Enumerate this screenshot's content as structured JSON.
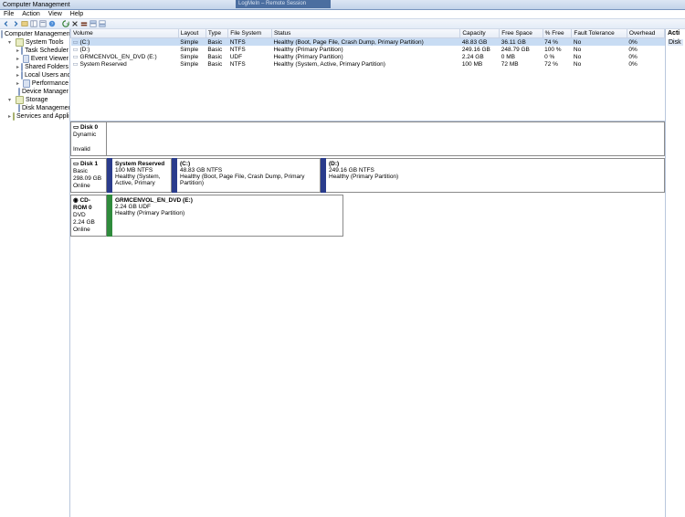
{
  "title": "Computer Management",
  "remote_bar": "LogMeIn – Remote Session",
  "menu": {
    "file": "File",
    "action": "Action",
    "view": "View",
    "help": "Help"
  },
  "tree": {
    "root": "Computer Management (Local)",
    "system_tools": "System Tools",
    "task_scheduler": "Task Scheduler",
    "event_viewer": "Event Viewer",
    "shared_folders": "Shared Folders",
    "local_users": "Local Users and Groups",
    "performance": "Performance",
    "device_manager": "Device Manager",
    "storage": "Storage",
    "disk_mgmt": "Disk Management",
    "services_apps": "Services and Applications"
  },
  "actions_label": "Acti",
  "actions_item": "Disk",
  "columns": {
    "volume": "Volume",
    "layout": "Layout",
    "type": "Type",
    "fs": "File System",
    "status": "Status",
    "capacity": "Capacity",
    "free": "Free Space",
    "pct": "% Free",
    "fault": "Fault Tolerance",
    "overhead": "Overhead"
  },
  "volumes": [
    {
      "name": "(C:)",
      "layout": "Simple",
      "type": "Basic",
      "fs": "NTFS",
      "status": "Healthy (Boot, Page File, Crash Dump, Primary Partition)",
      "cap": "48.83 GB",
      "free": "36.11 GB",
      "pct": "74 %",
      "fault": "No",
      "oh": "0%"
    },
    {
      "name": "(D:)",
      "layout": "Simple",
      "type": "Basic",
      "fs": "NTFS",
      "status": "Healthy (Primary Partition)",
      "cap": "249.16 GB",
      "free": "248.79 GB",
      "pct": "100 %",
      "fault": "No",
      "oh": "0%"
    },
    {
      "name": "GRMCENVOL_EN_DVD (E:)",
      "layout": "Simple",
      "type": "Basic",
      "fs": "UDF",
      "status": "Healthy (Primary Partition)",
      "cap": "2.24 GB",
      "free": "0 MB",
      "pct": "0 %",
      "fault": "No",
      "oh": "0%"
    },
    {
      "name": "System Reserved",
      "layout": "Simple",
      "type": "Basic",
      "fs": "NTFS",
      "status": "Healthy (System, Active, Primary Partition)",
      "cap": "100 MB",
      "free": "72 MB",
      "pct": "72 %",
      "fault": "No",
      "oh": "0%"
    }
  ],
  "disks": {
    "d0": {
      "label": "Disk 0",
      "type": "Dynamic",
      "status": "Invalid"
    },
    "d1": {
      "label": "Disk 1",
      "type": "Basic",
      "size": "298.09 GB",
      "status": "Online",
      "p1": {
        "name": "System Reserved",
        "info": "100 MB NTFS",
        "stat": "Healthy (System, Active, Primary"
      },
      "p2": {
        "name": "(C:)",
        "info": "48.83 GB NTFS",
        "stat": "Healthy (Boot, Page File, Crash Dump, Primary Partition)"
      },
      "p3": {
        "name": "(D:)",
        "info": "249.16 GB NTFS",
        "stat": "Healthy (Primary Partition)"
      }
    },
    "cd": {
      "label": "CD-ROM 0",
      "type": "DVD",
      "size": "2.24 GB",
      "status": "Online",
      "p1": {
        "name": "GRMCENVOL_EN_DVD  (E:)",
        "info": "2.24 GB UDF",
        "stat": "Healthy (Primary Partition)"
      }
    }
  }
}
